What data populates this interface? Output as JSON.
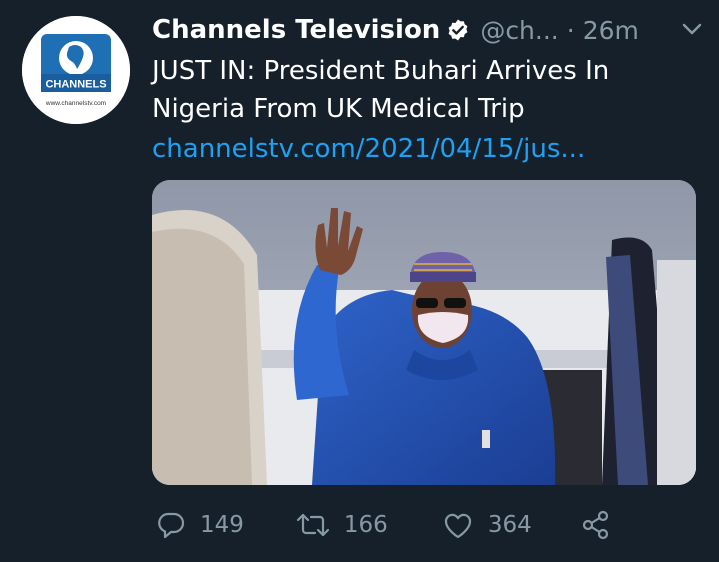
{
  "tweet": {
    "author_name": "Channels Television",
    "handle": "@ch...",
    "separator": "·",
    "time": "26m",
    "text": "JUST IN: President Buhari Arrives In Nigeria From UK Medical Trip",
    "link_text": "channelstv.com/2021/04/15/jus...",
    "avatar": {
      "logo_text": "CHANNELS",
      "website": "www.channelstv.com"
    }
  },
  "actions": {
    "replies": "149",
    "retweets": "166",
    "likes": "364"
  },
  "icons": {
    "verified": "verified-badge-icon",
    "caret": "chevron-down-icon",
    "reply": "reply-icon",
    "retweet": "retweet-icon",
    "like": "heart-icon",
    "share": "share-icon"
  },
  "colors": {
    "background": "#15202b",
    "text": "#ffffff",
    "muted": "#8899a6",
    "link": "#1da1f2"
  }
}
